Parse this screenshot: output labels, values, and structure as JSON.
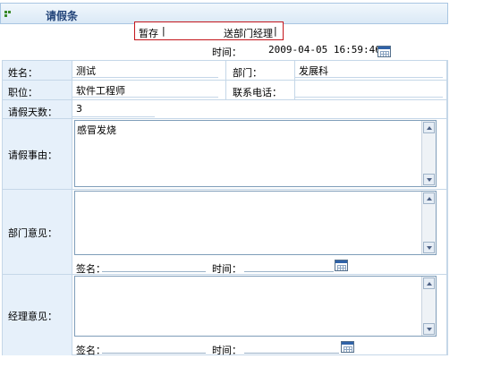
{
  "header": {
    "title": "请假条"
  },
  "actions": {
    "save": "暂存",
    "send": "送部门经理",
    "separator": "|"
  },
  "time": {
    "label": "时间：",
    "value": "2009-04-05 16:59:46"
  },
  "form": {
    "name_label": "姓名：",
    "name_value": "测试",
    "dept_label": "部门：",
    "dept_value": "发展科",
    "position_label": "职位：",
    "position_value": "软件工程师",
    "phone_label": "联系电话：",
    "phone_value": "",
    "days_label": "请假天数：",
    "days_value": "3",
    "reason_label": "请假事由：",
    "reason_value": "感冒发烧",
    "dept_opinion_label": "部门意见：",
    "dept_opinion_value": "",
    "mgr_opinion_label": "经理意见：",
    "mgr_opinion_value": "",
    "sign_label": "签名：",
    "sign_time_label": "时间："
  },
  "icons": {
    "title": "title-grid-icon",
    "calendar": "calendar-icon"
  }
}
